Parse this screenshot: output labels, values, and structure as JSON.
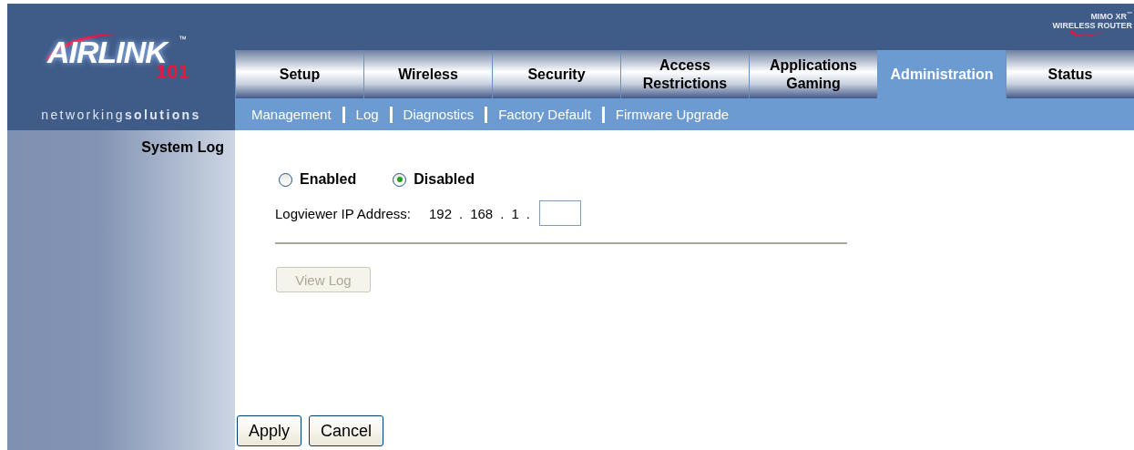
{
  "logo": {
    "brand": "AIRLINK",
    "trademark": "™",
    "number": "101",
    "tagline": "networking**solutions**"
  },
  "badge": {
    "line_1": "MIMO XR",
    "trademark": "™",
    "line_2": "WIRELESS ROUTER"
  },
  "tabs": [
    {
      "label": "Setup",
      "selected": false
    },
    {
      "label": "Wireless",
      "selected": false
    },
    {
      "label": "Security",
      "selected": false
    },
    {
      "label": "Access Restrictions",
      "selected": false
    },
    {
      "label": "Applications Gaming",
      "selected": false
    },
    {
      "label": "Administration",
      "selected": true
    },
    {
      "label": "Status",
      "selected": false
    }
  ],
  "subnav": [
    {
      "label": "Management"
    },
    {
      "label": "Log"
    },
    {
      "label": "Diagnostics"
    },
    {
      "label": "Factory Default"
    },
    {
      "label": "Firmware Upgrade"
    }
  ],
  "section_title": "System Log",
  "log_mode": [
    {
      "label": "Enabled",
      "selected": false
    },
    {
      "label": "Disabled",
      "selected": true
    }
  ],
  "logviewer": {
    "label": "Logviewer IP Address:",
    "parts": [
      "192",
      ".",
      "168",
      ".",
      "1",
      "."
    ]
  },
  "view_log": {
    "label": "View Log",
    "disabled": true
  },
  "buttons": [
    "Apply",
    "Cancel"
  ]
}
